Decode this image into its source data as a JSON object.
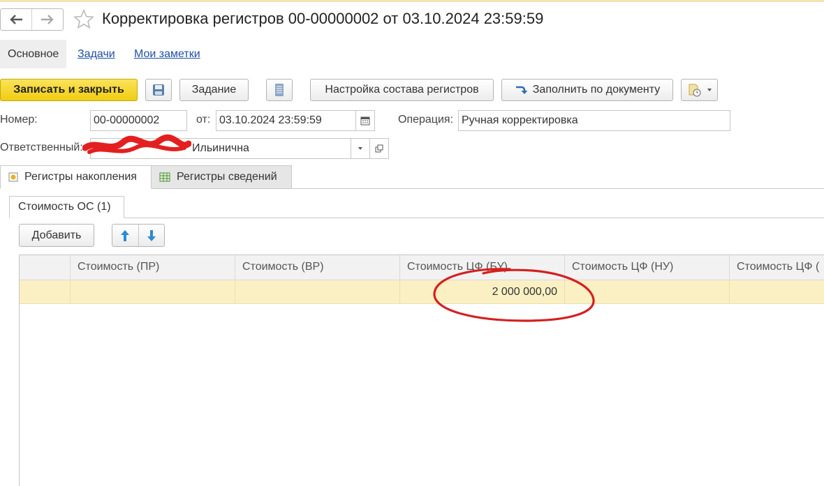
{
  "window": {
    "title": "Корректировка регистров 00-00000002 от 03.10.2024 23:59:59"
  },
  "sections": {
    "main": "Основное",
    "tasks": "Задачи",
    "notes": "Мои заметки"
  },
  "toolbar": {
    "save_close": "Записать и закрыть",
    "task": "Задание",
    "settings": "Настройка состава регистров",
    "fill": "Заполнить по документу"
  },
  "form": {
    "number_label": "Номер:",
    "number_value": "00-00000002",
    "date_label": "от:",
    "date_value": "03.10.2024 23:59:59",
    "operation_label": "Операция:",
    "operation_value": "Ручная корректировка",
    "responsible_label": "Ответственный:",
    "responsible_value": "Ильинична"
  },
  "register_tabs": {
    "accumulation": "Регистры накопления",
    "info": "Регистры сведений"
  },
  "subtab": "Стоимость ОС (1)",
  "table_toolbar": {
    "add": "Добавить"
  },
  "table": {
    "columns": [
      "",
      "Стоимость (ПР)",
      "Стоимость (ВР)",
      "Стоимость ЦФ (БУ)",
      "Стоимость ЦФ (НУ)",
      "Стоимость ЦФ ("
    ],
    "rows": [
      [
        "",
        "",
        "",
        "2 000 000,00",
        "",
        ""
      ]
    ]
  },
  "colors": {
    "primary_button": "#f0cd11",
    "selected_row": "#fbf0c3",
    "link": "#1f4fa6",
    "annotation": "#d42020"
  }
}
